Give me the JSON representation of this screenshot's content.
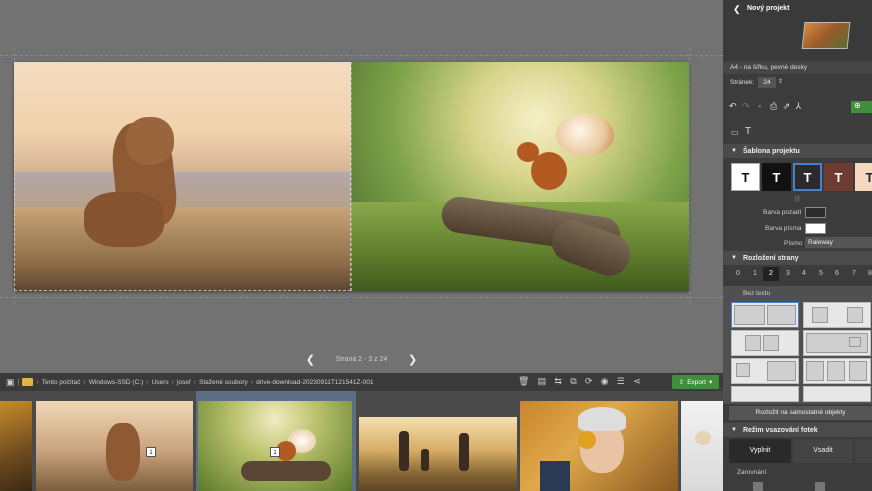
{
  "pager": {
    "prev": "❮",
    "label": "Strana 2 - 3 z 24",
    "next": "❯"
  },
  "browser": {
    "crumbs": [
      "Tento počítač",
      "Windows-SSD (C:)",
      "Users",
      "josef",
      "Stažené soubory",
      "drive-download-20230911T121541Z-001"
    ],
    "export_label": "Export"
  },
  "thumbs": {
    "badge_1": "1",
    "badge_2": "1"
  },
  "panel": {
    "back": "❮",
    "title": "Nový projekt",
    "product": "A4 - na šířku, pevné desky",
    "pages_label": "Stránek:",
    "pages_value": "24",
    "text_icon": "T",
    "sec_template": "Šablona projektu",
    "swatch_letter": "T",
    "swatch_colors": [
      "#ffffff",
      "#111111",
      "#2b2b2b",
      "#6e3b33",
      "#f4d9bf"
    ],
    "bg_color_label": "Barva pozadí",
    "bg_color": "#2b2b2b",
    "font_color_label": "Barva písma",
    "font_color": "#ffffff",
    "font_label": "Písmo",
    "font_value": "Raleway",
    "sec_layout": "Rozložení strany",
    "layout_nums": [
      "0",
      "1",
      "2",
      "3",
      "4",
      "5",
      "6",
      "7",
      "8"
    ],
    "no_text": "Bez textu",
    "split_btn": "Rozložit na samostatné objekty",
    "sec_fit": "Režim vsazování fotek",
    "fill_label": "Vyplnit",
    "fit_label": "Vsadit",
    "align_label": "Zarovnání",
    "accent": "#3f8f3c"
  }
}
